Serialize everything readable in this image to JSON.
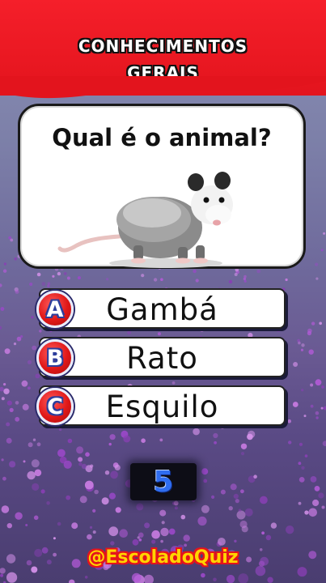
{
  "header": {
    "title_line1": "CONHECIMENTOS",
    "title_line2": "GERAIS"
  },
  "question": {
    "text": "Qual é o animal?",
    "image_icon": "opossum-image"
  },
  "answers": [
    {
      "letter": "A",
      "label": "Gambá"
    },
    {
      "letter": "B",
      "label": "Rato"
    },
    {
      "letter": "C",
      "label": "Esquilo"
    }
  ],
  "timer": {
    "value": "5"
  },
  "footer": {
    "handle": "@EscoladoQuiz"
  },
  "colors": {
    "header_red": "#e3141d",
    "badge_red": "#e01818",
    "timer_blue": "#2f6df0",
    "handle_yellow": "#ffd400"
  }
}
